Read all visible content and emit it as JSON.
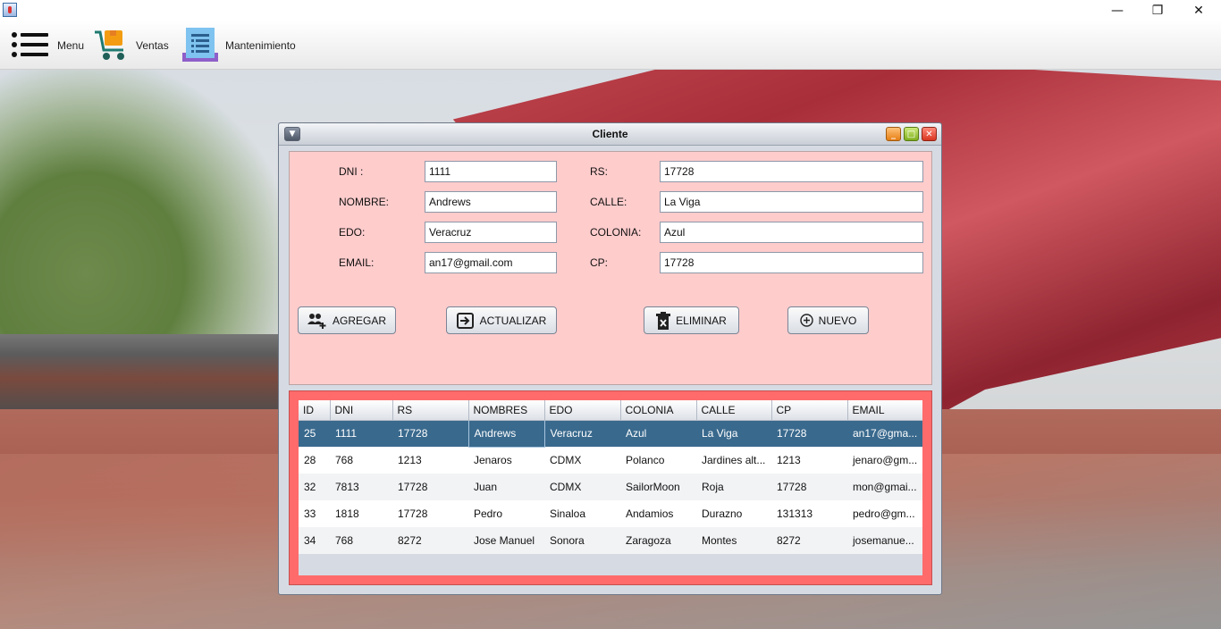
{
  "window": {
    "controls": {
      "minimize": "—",
      "restore": "❐",
      "close": "✕"
    }
  },
  "menubar": {
    "items": [
      {
        "label": "Menu",
        "icon": "hamburger-menu-icon"
      },
      {
        "label": "Ventas",
        "icon": "shopping-cart-icon"
      },
      {
        "label": "Mantenimiento",
        "icon": "document-list-icon"
      }
    ]
  },
  "frame": {
    "title": "Cliente"
  },
  "form": {
    "left": [
      {
        "label": "DNI :",
        "value": "1111"
      },
      {
        "label": "NOMBRE:",
        "value": "Andrews"
      },
      {
        "label": "EDO:",
        "value": "Veracruz"
      },
      {
        "label": "EMAIL:",
        "value": "an17@gmail.com"
      }
    ],
    "right": [
      {
        "label": "RS:",
        "value": "17728"
      },
      {
        "label": "CALLE:",
        "value": "La Viga"
      },
      {
        "label": "COLONIA:",
        "value": "Azul"
      },
      {
        "label": "CP:",
        "value": "17728"
      }
    ]
  },
  "buttons": {
    "agregar": "AGREGAR",
    "actualizar": "ACTUALIZAR",
    "eliminar": "ELIMINAR",
    "nuevo": "NUEVO"
  },
  "table": {
    "columns": [
      "ID",
      "DNI",
      "RS",
      "NOMBRES",
      "EDO",
      "COLONIA",
      "CALLE",
      "CP",
      "EMAIL"
    ],
    "rows": [
      [
        "25",
        "1111",
        "17728",
        "Andrews",
        "Veracruz",
        "Azul",
        "La Viga",
        "17728",
        "an17@gma..."
      ],
      [
        "28",
        "768",
        "1213",
        "Jenaros",
        "CDMX",
        "Polanco",
        "Jardines alt...",
        "1213",
        "jenaro@gm..."
      ],
      [
        "32",
        "7813",
        "17728",
        "Juan",
        "CDMX",
        "SailorMoon",
        "Roja",
        "17728",
        "mon@gmai..."
      ],
      [
        "33",
        "1818",
        "17728",
        "Pedro",
        "Sinaloa",
        "Andamios",
        "Durazno",
        "131313",
        "pedro@gm..."
      ],
      [
        "34",
        "768",
        "8272",
        "Jose Manuel",
        "Sonora",
        "Zaragoza",
        "Montes",
        "8272",
        "josemanue..."
      ]
    ],
    "selected_row": 0,
    "colors": {
      "selected": "#39698d",
      "panel": "#ff6b6b",
      "form_bg": "#ffcccc"
    }
  }
}
